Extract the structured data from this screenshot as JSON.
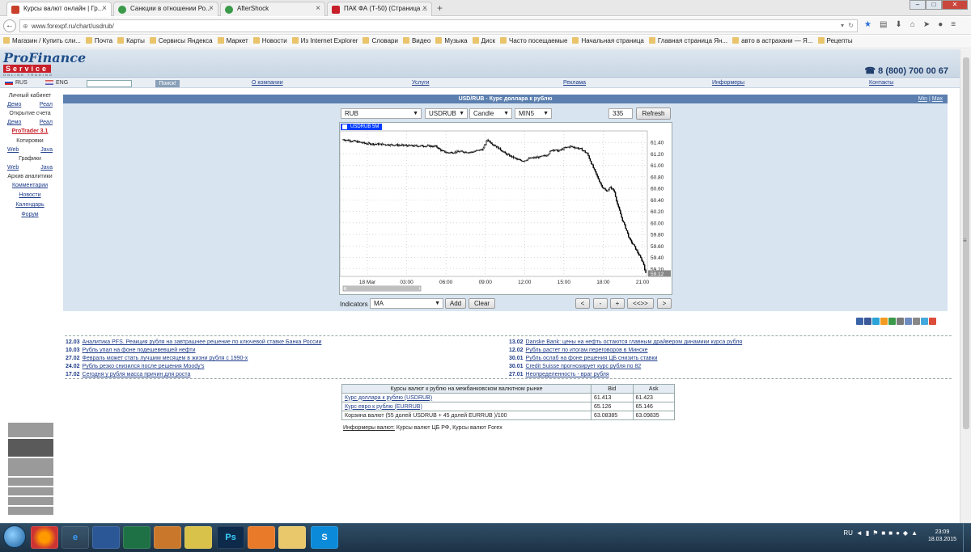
{
  "browser": {
    "tabs": [
      {
        "title": "Курсы валют онлайн | Гр...",
        "active": true,
        "fav_color": "#c8402a"
      },
      {
        "title": "Санкции в отношении Ро...",
        "active": false,
        "fav_color": "#3a9a4a"
      },
      {
        "title": "AfterShock",
        "active": false,
        "fav_color": "#3a9a4a"
      },
      {
        "title": "ПАК ФА (Т-50) (Страница ...",
        "active": false,
        "fav_color": "#c8202a"
      }
    ],
    "new_tab": "+",
    "url": "www.forexpf.ru/chart/usdrub/",
    "bookmarks": [
      "Магазин / Купить сли...",
      "Почта",
      "Карты",
      "Сервисы Яндекса",
      "Маркет",
      "Новости",
      "Из Internet Explorer",
      "Словари",
      "Видео",
      "Музыка",
      "Диск",
      "Часто посещаемые",
      "Начальная страница",
      "Главная страница Ян...",
      "авто в астрахани — Я...",
      "Рецепты"
    ]
  },
  "site": {
    "logo_top": "ProFinance",
    "logo_mid": "Service",
    "logo_bottom": "ONLINE TRADING",
    "phone": "☎ 8 (800) 700 00 67",
    "lang_ru": "RUS",
    "lang_en": "ENG",
    "search_button": "Поиск!",
    "nav": [
      "О компании",
      "Услуги",
      "Реклама",
      "Информеры",
      "Контакты"
    ]
  },
  "sidebar": {
    "personal_cabinet": "Личный кабинет",
    "demo": "Демо",
    "real": "Реал",
    "open_account": "Открытие счета",
    "protrader": "ProTrader 3.1",
    "quotes": "Котировки",
    "web": "Web",
    "java": "Java",
    "charts": "Графики",
    "analytics_archive": "Архив аналитики",
    "comments": "Комментарии",
    "news": "Новости",
    "calendar": "Календарь",
    "forum": "Форум"
  },
  "chart_panel": {
    "title": "USD/RUB - Курс доллара к рублю",
    "min": "Min",
    "separator": "|",
    "max": "Max",
    "currency": "RUB",
    "instrument": "USDRUB",
    "chart_type": "Candle",
    "period": "MIN5",
    "bars": "335",
    "refresh": "Refresh",
    "indicators_label": "Indicators",
    "indicator": "MA",
    "add": "Add",
    "clear": "Clear",
    "nav_buttons": [
      "<",
      "-",
      "+",
      "<<>>",
      ">"
    ]
  },
  "chart_data": {
    "type": "candlestick",
    "instrument_tag": "USDRUB 5M",
    "x_ticks": [
      "18 Mar",
      "03:00",
      "06:00",
      "09:00",
      "12:00",
      "15:00",
      "18:00",
      "21:00"
    ],
    "y_ticks": [
      61.4,
      61.2,
      61.0,
      60.8,
      60.6,
      60.4,
      60.2,
      60.0,
      59.8,
      59.6,
      59.4,
      59.2
    ],
    "ylim": [
      59.07,
      61.6
    ],
    "last_price_label": "59.12",
    "last_price": 59.12,
    "grid": true,
    "close_path": [
      [
        0,
        61.45
      ],
      [
        1.0,
        61.42
      ],
      [
        2.0,
        61.38
      ],
      [
        3.0,
        61.37
      ],
      [
        4.0,
        61.36
      ],
      [
        5.0,
        61.35
      ],
      [
        6.0,
        61.34
      ],
      [
        7.0,
        61.34
      ],
      [
        8.0,
        61.33
      ],
      [
        8.5,
        61.25
      ],
      [
        9.0,
        61.22
      ],
      [
        10.0,
        61.24
      ],
      [
        11.0,
        61.23
      ],
      [
        12.0,
        61.28
      ],
      [
        12.4,
        61.45
      ],
      [
        12.8,
        61.38
      ],
      [
        13.5,
        61.28
      ],
      [
        14.0,
        61.2
      ],
      [
        15.0,
        61.1
      ],
      [
        15.5,
        61.08
      ],
      [
        16.0,
        61.12
      ],
      [
        17.0,
        61.15
      ],
      [
        17.5,
        61.18
      ],
      [
        18.0,
        61.28
      ],
      [
        18.5,
        61.25
      ],
      [
        19.0,
        61.3
      ],
      [
        19.5,
        61.33
      ],
      [
        20.0,
        61.31
      ],
      [
        20.5,
        61.28
      ],
      [
        21.0,
        61.2
      ],
      [
        21.4,
        61.0
      ],
      [
        21.8,
        60.82
      ],
      [
        22.2,
        60.65
      ],
      [
        22.6,
        60.55
      ],
      [
        23.0,
        60.62
      ],
      [
        23.3,
        60.55
      ],
      [
        23.6,
        60.3
      ],
      [
        24.0,
        60.05
      ],
      [
        24.3,
        59.9
      ],
      [
        24.6,
        59.72
      ],
      [
        25.0,
        59.6
      ],
      [
        25.4,
        59.45
      ],
      [
        25.8,
        59.3
      ],
      [
        26.0,
        59.12
      ]
    ]
  },
  "social_colors": [
    "#3b64a8",
    "#3b5998",
    "#2aa3d6",
    "#f29b22",
    "#3a9a4a",
    "#7a7a7a",
    "#6d8bc0",
    "#888888",
    "#44aadd",
    "#dd4b39"
  ],
  "news": {
    "left": [
      {
        "date": "12.03",
        "text": "Аналитика PFS. Реакция рубля на завтрашнее решение по ключевой ставке Банка России"
      },
      {
        "date": "10.03",
        "text": "Рубль упал на фоне подешевевшей нефти"
      },
      {
        "date": "27.02",
        "text": "Февраль может стать лучшим месяцем в жизни рубля с 1990-х"
      },
      {
        "date": "24.02",
        "text": "Рубль резко снизился после решения Moody's"
      },
      {
        "date": "17.02",
        "text": "Сегодня у рубля масса причин для роста"
      }
    ],
    "right": [
      {
        "date": "13.02",
        "text": "Danske Bank: цены на нефть остаются главным драйвером динамики курса рубля"
      },
      {
        "date": "12.02",
        "text": "Рубль растет по итогам переговоров в Минске"
      },
      {
        "date": "30.01",
        "text": "Рубль ослаб на фоне решения ЦБ снизить ставки"
      },
      {
        "date": "30.01",
        "text": "Credit Suisse прогнозирует курс рубля по 82"
      },
      {
        "date": "27.01",
        "text": "Неопределенность - враг рубля"
      }
    ]
  },
  "rates_table": {
    "header": "Курсы валют к рублю на межбанковском валютном рынке",
    "bid": "Bid",
    "ask": "Ask",
    "rows": [
      {
        "name": "Курс доллара к рублю (USDRUB)",
        "bid": "61.413",
        "ask": "61.423",
        "link": true
      },
      {
        "name": "Курс евро к рублю (EURRUB)",
        "bid": "65.126",
        "ask": "65.146",
        "link": true
      },
      {
        "name": "Корзина валют (55 долей USDRUB + 45 долей EURRUB )/100",
        "bid": "63.08385",
        "ask": "63.09835",
        "link": false
      }
    ]
  },
  "informers": {
    "label": "Информеры валют:",
    "text": " Курсы валют ЦБ РФ, Курсы валют Forex"
  },
  "taskbar": {
    "lang": "RU",
    "time": "23:09",
    "date": "18.03.2015",
    "apps": [
      "",
      "",
      "",
      "",
      "",
      "",
      "Ps",
      "",
      "",
      "S"
    ]
  }
}
